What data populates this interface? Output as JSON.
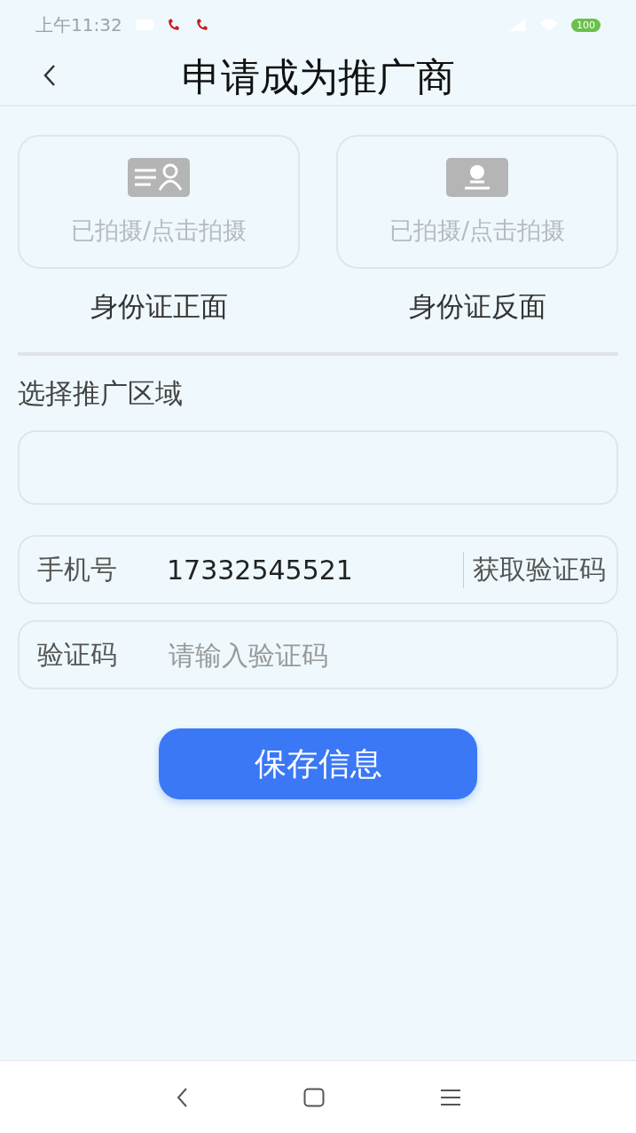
{
  "status_bar": {
    "time": "上午11:32",
    "battery": "100"
  },
  "header": {
    "title": "申请成为推广商"
  },
  "id_cards": [
    {
      "kind": "front",
      "hint": "已拍摄/点击拍摄",
      "label": "身份证正面"
    },
    {
      "kind": "back",
      "hint": "已拍摄/点击拍摄",
      "label": "身份证反面"
    }
  ],
  "region": {
    "label": "选择推广区域"
  },
  "phone": {
    "label": "手机号",
    "value": "17332545521",
    "action": "获取验证码"
  },
  "code": {
    "label": "验证码",
    "placeholder": "请输入验证码"
  },
  "save_button": "保存信息"
}
